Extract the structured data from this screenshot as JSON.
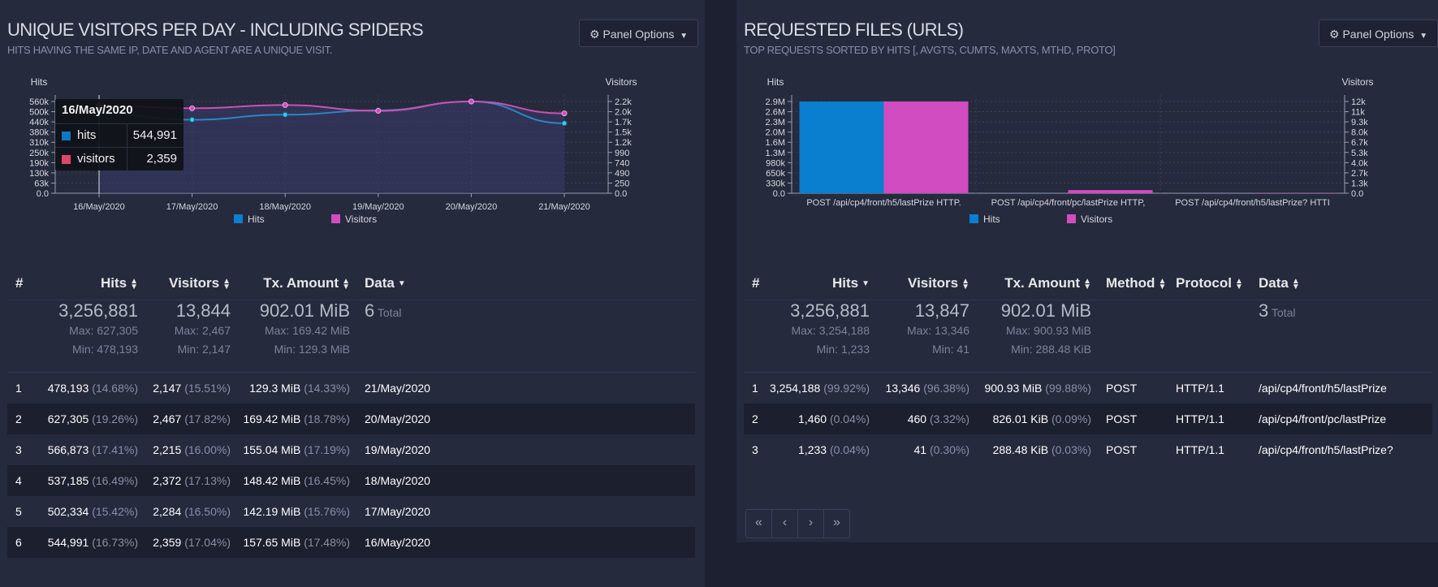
{
  "left_panel": {
    "title": "UNIQUE VISITORS PER DAY - INCLUDING SPIDERS",
    "subtitle": "HITS HAVING THE SAME IP, DATE AND AGENT ARE A UNIQUE VISIT.",
    "options_label": "Panel Options",
    "tooltip": {
      "date": "16/May/2020",
      "hits_label": "hits",
      "hits_value": "544,991",
      "visitors_label": "visitors",
      "visitors_value": "2,359"
    },
    "table": {
      "headers": [
        "#",
        "Hits",
        "Visitors",
        "Tx. Amount",
        "Data"
      ],
      "summary": {
        "hits_total": "3,256,881",
        "hits_max": "Max: 627,305",
        "hits_min": "Min: 478,193",
        "visitors_total": "13,844",
        "visitors_max": "Max: 2,467",
        "visitors_min": "Min: 2,147",
        "tx_total": "902.01 MiB",
        "tx_max": "Max: 169.42 MiB",
        "tx_min": "Min: 129.3 MiB",
        "data_total": "6",
        "data_total_word": "Total"
      },
      "rows": [
        {
          "idx": "1",
          "hits": "478,193",
          "hits_pct": "(14.68%)",
          "visitors": "2,147",
          "visitors_pct": "(15.51%)",
          "tx": "129.3 MiB",
          "tx_pct": "(14.33%)",
          "data": "21/May/2020"
        },
        {
          "idx": "2",
          "hits": "627,305",
          "hits_pct": "(19.26%)",
          "visitors": "2,467",
          "visitors_pct": "(17.82%)",
          "tx": "169.42 MiB",
          "tx_pct": "(18.78%)",
          "data": "20/May/2020"
        },
        {
          "idx": "3",
          "hits": "566,873",
          "hits_pct": "(17.41%)",
          "visitors": "2,215",
          "visitors_pct": "(16.00%)",
          "tx": "155.04 MiB",
          "tx_pct": "(17.19%)",
          "data": "19/May/2020"
        },
        {
          "idx": "4",
          "hits": "537,185",
          "hits_pct": "(16.49%)",
          "visitors": "2,372",
          "visitors_pct": "(17.13%)",
          "tx": "148.42 MiB",
          "tx_pct": "(16.45%)",
          "data": "18/May/2020"
        },
        {
          "idx": "5",
          "hits": "502,334",
          "hits_pct": "(15.42%)",
          "visitors": "2,284",
          "visitors_pct": "(16.50%)",
          "tx": "142.19 MiB",
          "tx_pct": "(15.76%)",
          "data": "17/May/2020"
        },
        {
          "idx": "6",
          "hits": "544,991",
          "hits_pct": "(16.73%)",
          "visitors": "2,359",
          "visitors_pct": "(17.04%)",
          "tx": "157.65 MiB",
          "tx_pct": "(17.48%)",
          "data": "16/May/2020"
        }
      ]
    }
  },
  "right_panel": {
    "title": "REQUESTED FILES (URLS)",
    "subtitle": "TOP REQUESTS SORTED BY HITS [, AVGTS, CUMTS, MAXTS, MTHD, PROTO]",
    "options_label": "Panel Options",
    "table": {
      "headers": [
        "#",
        "Hits",
        "Visitors",
        "Tx. Amount",
        "Method",
        "Protocol",
        "Data"
      ],
      "summary": {
        "hits_total": "3,256,881",
        "hits_max": "Max: 3,254,188",
        "hits_min": "Min: 1,233",
        "visitors_total": "13,847",
        "visitors_max": "Max: 13,346",
        "visitors_min": "Min: 41",
        "tx_total": "902.01 MiB",
        "tx_max": "Max: 900.93 MiB",
        "tx_min": "Min: 288.48 KiB",
        "data_total": "3",
        "data_total_word": "Total"
      },
      "rows": [
        {
          "idx": "1",
          "hits": "3,254,188",
          "hits_pct": "(99.92%)",
          "visitors": "13,346",
          "visitors_pct": "(96.38%)",
          "tx": "900.93 MiB",
          "tx_pct": "(99.88%)",
          "method": "POST",
          "protocol": "HTTP/1.1",
          "data": "/api/cp4/front/h5/lastPrize"
        },
        {
          "idx": "2",
          "hits": "1,460",
          "hits_pct": "(0.04%)",
          "visitors": "460",
          "visitors_pct": "(3.32%)",
          "tx": "826.01 KiB",
          "tx_pct": "(0.09%)",
          "method": "POST",
          "protocol": "HTTP/1.1",
          "data": "/api/cp4/front/pc/lastPrize"
        },
        {
          "idx": "3",
          "hits": "1,233",
          "hits_pct": "(0.04%)",
          "visitors": "41",
          "visitors_pct": "(0.30%)",
          "tx": "288.48 KiB",
          "tx_pct": "(0.03%)",
          "method": "POST",
          "protocol": "HTTP/1.1",
          "data": "/api/cp4/front/h5/lastPrize?"
        }
      ]
    },
    "pager": [
      "«",
      "‹",
      "›",
      "»"
    ]
  },
  "colors": {
    "hits": "#0a7fcf",
    "visitors": "#d14cc0",
    "hits_line": "#2b86c6",
    "visitors_line": "#cd4fb2"
  },
  "chart_data": [
    {
      "type": "line",
      "x": [
        "16/May/2020",
        "17/May/2020",
        "18/May/2020",
        "19/May/2020",
        "20/May/2020",
        "21/May/2020"
      ],
      "series": [
        {
          "name": "Hits",
          "axis": "left",
          "values": [
            544991,
            502334,
            537185,
            566873,
            627305,
            478193
          ]
        },
        {
          "name": "Visitors",
          "axis": "right",
          "values": [
            2359,
            2284,
            2372,
            2215,
            2467,
            2147
          ]
        }
      ],
      "ylabel": "Hits",
      "y2label": "Visitors",
      "ylim": [
        0,
        627305
      ],
      "y2lim": [
        0,
        2467
      ],
      "yticks": [
        "0.0",
        "63k",
        "130k",
        "190k",
        "250k",
        "310k",
        "380k",
        "440k",
        "500k",
        "560k"
      ],
      "y2ticks": [
        "0.0",
        "250",
        "490",
        "740",
        "990",
        "1.2k",
        "1.5k",
        "1.7k",
        "2.0k",
        "2.2k"
      ],
      "legend": [
        "Hits",
        "Visitors"
      ],
      "legend_position": "bottom",
      "grid": true
    },
    {
      "type": "bar",
      "categories": [
        "POST /api/cp4/front/h5/lastPrize HTTP.",
        "POST /api/cp4/front/pc/lastPrize HTTP,",
        "POST /api/cp4/front/h5/lastPrize? HTTI"
      ],
      "series": [
        {
          "name": "Hits",
          "axis": "left",
          "values": [
            3254188,
            1460,
            1233
          ]
        },
        {
          "name": "Visitors",
          "axis": "right",
          "values": [
            13346,
            460,
            41
          ]
        }
      ],
      "ylabel": "Hits",
      "y2label": "Visitors",
      "ylim": [
        0,
        3254188
      ],
      "y2lim": [
        0,
        13346
      ],
      "yticks": [
        "0.0",
        "330k",
        "650k",
        "980k",
        "1.3M",
        "1.6M",
        "2.0M",
        "2.3M",
        "2.6M",
        "2.9M"
      ],
      "y2ticks": [
        "0.0",
        "1.3k",
        "2.7k",
        "4.0k",
        "5.3k",
        "6.7k",
        "8.0k",
        "9.3k",
        "11k",
        "12k"
      ],
      "legend": [
        "Hits",
        "Visitors"
      ],
      "legend_position": "bottom",
      "grid": true
    }
  ]
}
